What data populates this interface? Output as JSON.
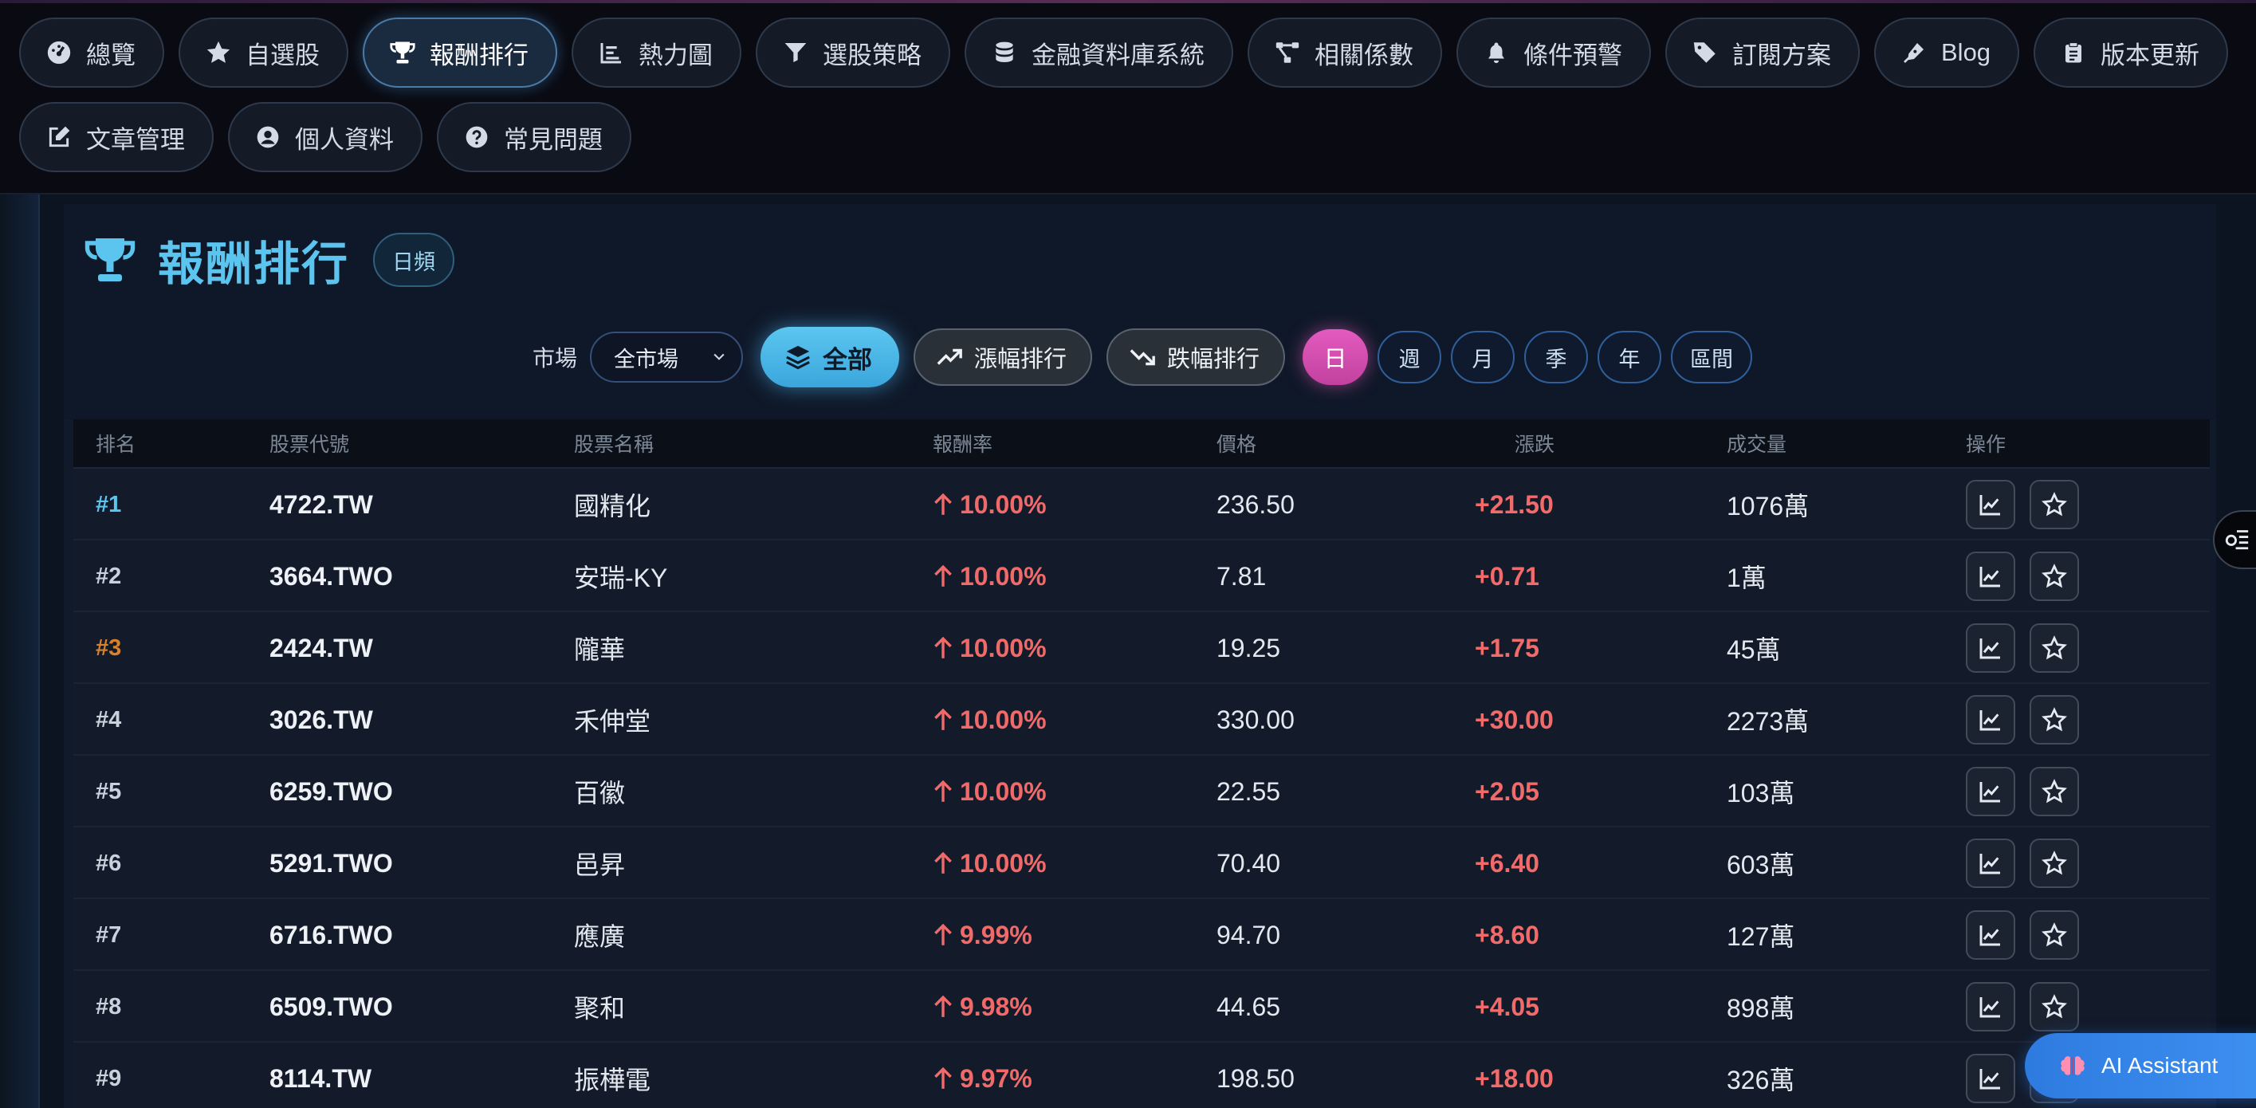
{
  "nav": {
    "row1": [
      {
        "label": "總覽",
        "icon": "dashboard-icon"
      },
      {
        "label": "自選股",
        "icon": "star-icon"
      },
      {
        "label": "報酬排行",
        "icon": "trophy-icon",
        "active": true
      },
      {
        "label": "熱力圖",
        "icon": "bar-chart-icon"
      },
      {
        "label": "選股策略",
        "icon": "filter-icon"
      },
      {
        "label": "金融資料庫系統",
        "icon": "database-icon"
      },
      {
        "label": "相關係數",
        "icon": "nodes-icon"
      },
      {
        "label": "條件預警",
        "icon": "bell-icon"
      },
      {
        "label": "訂閱方案",
        "icon": "tags-icon"
      },
      {
        "label": "Blog",
        "icon": "pen-icon"
      },
      {
        "label": "版本更新",
        "icon": "clipboard-icon"
      }
    ],
    "row2": [
      {
        "label": "文章管理",
        "icon": "edit-icon"
      },
      {
        "label": "個人資料",
        "icon": "user-circle-icon"
      },
      {
        "label": "常見問題",
        "icon": "question-icon"
      }
    ]
  },
  "page": {
    "title": "報酬排行",
    "freq_badge": "日頻"
  },
  "filters": {
    "market_label": "市場",
    "market_selected": "全市場",
    "all_label": "全部",
    "gain_label": "漲幅排行",
    "loss_label": "跌幅排行",
    "periods": [
      "日",
      "週",
      "月",
      "季",
      "年",
      "區間"
    ],
    "active_period": "日"
  },
  "table": {
    "headers": [
      "排名",
      "股票代號",
      "股票名稱",
      "報酬率",
      "價格",
      "漲跌",
      "成交量",
      "操作"
    ],
    "rows": [
      {
        "rank": "#1",
        "code": "4722.TW",
        "name": "國精化",
        "ret": "10.00%",
        "price": "236.50",
        "chg": "+21.50",
        "vol": "1076萬"
      },
      {
        "rank": "#2",
        "code": "3664.TWO",
        "name": "安瑞-KY",
        "ret": "10.00%",
        "price": "7.81",
        "chg": "+0.71",
        "vol": "1萬"
      },
      {
        "rank": "#3",
        "code": "2424.TW",
        "name": "隴華",
        "ret": "10.00%",
        "price": "19.25",
        "chg": "+1.75",
        "vol": "45萬"
      },
      {
        "rank": "#4",
        "code": "3026.TW",
        "name": "禾伸堂",
        "ret": "10.00%",
        "price": "330.00",
        "chg": "+30.00",
        "vol": "2273萬"
      },
      {
        "rank": "#5",
        "code": "6259.TWO",
        "name": "百徽",
        "ret": "10.00%",
        "price": "22.55",
        "chg": "+2.05",
        "vol": "103萬"
      },
      {
        "rank": "#6",
        "code": "5291.TWO",
        "name": "邑昇",
        "ret": "10.00%",
        "price": "70.40",
        "chg": "+6.40",
        "vol": "603萬"
      },
      {
        "rank": "#7",
        "code": "6716.TWO",
        "name": "應廣",
        "ret": "9.99%",
        "price": "94.70",
        "chg": "+8.60",
        "vol": "127萬"
      },
      {
        "rank": "#8",
        "code": "6509.TWO",
        "name": "聚和",
        "ret": "9.98%",
        "price": "44.65",
        "chg": "+4.05",
        "vol": "898萬"
      },
      {
        "rank": "#9",
        "code": "8114.TW",
        "name": "振樺電",
        "ret": "9.97%",
        "price": "198.50",
        "chg": "+18.00",
        "vol": "326萬"
      }
    ]
  },
  "assistant": {
    "label": "AI Assistant",
    "icon": "brain-icon"
  },
  "colors": {
    "accent": "#5bc4ef",
    "up": "#f06a6a",
    "rank1": "#5bc4ef",
    "rank3": "#d9822b",
    "period_active": "#d64fb2"
  }
}
